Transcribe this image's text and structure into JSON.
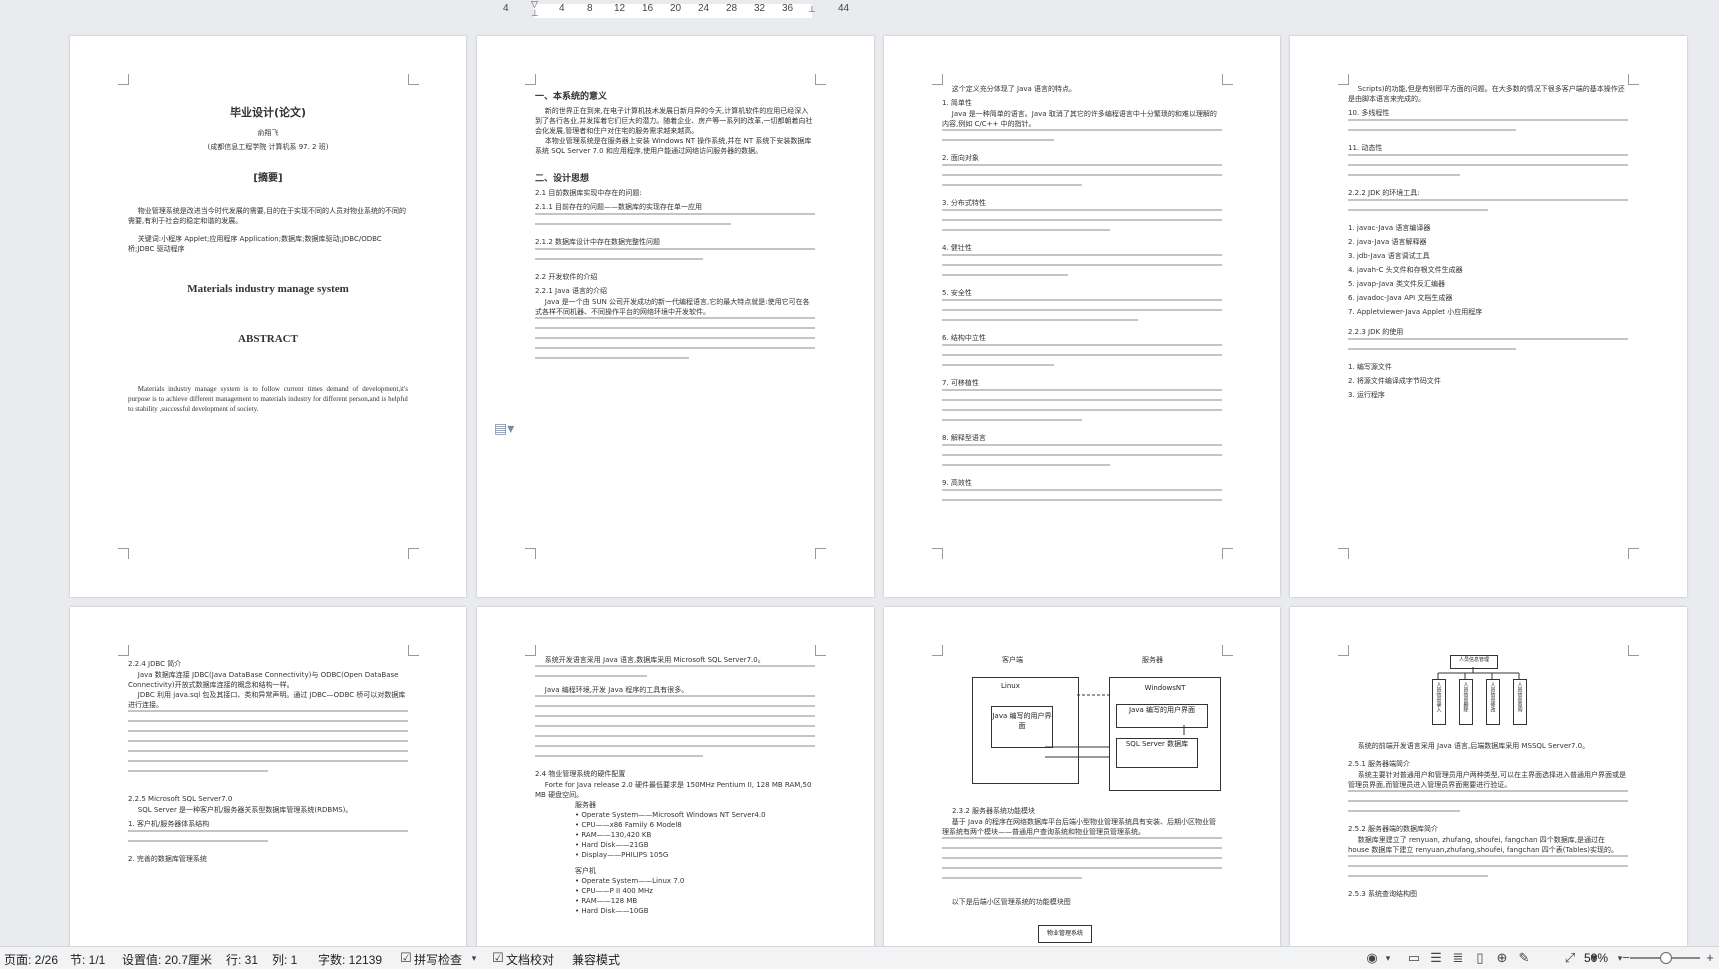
{
  "ruler": {
    "marks": [
      "4",
      "4",
      "8",
      "12",
      "16",
      "20",
      "24",
      "28",
      "32",
      "36",
      "44"
    ]
  },
  "page1": {
    "title": "毕业设计(论文)",
    "author": "俞翔飞",
    "affiliation": "(成都信息工程学院 计算机系 97. 2 班)",
    "abstract_cn_head": "[摘要]",
    "abstract_cn": "物业管理系统是改进当今时代发展的需要,目的在于实现不同的人员对物业系统的不同的需要,有利于社会的稳定和谐的发展。",
    "keywords_cn": "关键词:小程序 Applet;应用程序 Application;数据库;数据库驱动;JDBC/ODBC 桥;JDBC 驱动程序",
    "title_en": "Materials industry manage system",
    "abstract_en_head": "ABSTRACT",
    "abstract_en": "Materials industry manage system is to follow current times demand of development,it's purpose is to achieve different management to materials industry for different person,and is helpful to stability ,successful development of society."
  },
  "page2": {
    "h1": "一、本系统的意义",
    "p1": "新的世界正在到来,在电子计算机技术发展日新月异的今天,计算机软件的应用已经深入到了各行各业,并发挥着它们巨大的潜力。随着企业、房产等一系列的改革,一切都朝着向社会化发展,管理者和住户对住宅的服务需求越来越高。",
    "p2": "本物业管理系统是在服务器上安装 Windows NT 操作系统,并在 NT 系统下安装数据库系统 SQL Server 7.0 和应用程序,使用户能通过网络访问服务器的数据。",
    "h2": "二、设计思想",
    "s1": "2.1 目前数据库实现中存在的问题:",
    "s11": "2.1.1 目前存在的问题——数据库的实现存在单一应用",
    "s12": "2.1.2 数据库设计中存在数据完整性问题",
    "s22": "2.2 开发软件的介绍",
    "s221": "2.2.1 Java 语言的介绍",
    "p3": "Java 是一个由 SUN 公司开发成功的新一代编程语言,它的最大特点就是:使用它可在各式各样不同机器、不同操作平台的网络环境中开发软件。"
  },
  "page3": {
    "p1": "这个定义充分体现了 Java 语言的特点。",
    "items": [
      "1. 简单性",
      "2. 面向对象",
      "3. 分布式特性",
      "4. 健壮性",
      "5. 安全性",
      "6. 结构中立性",
      "7. 可移植性",
      "8. 解释型语言",
      "9. 高效性"
    ],
    "p2": "Java 是一种简单的语言。Java 取消了其它的许多编程语言中十分繁琐的和难以理解的内容,例如 C/C++ 中的指针。"
  },
  "page4": {
    "p1": "Scripts)的功能,但是有别即平方面的问题。在大多数的情况下很多客户端的基本操作还是由脚本语言来完成的。",
    "items": [
      "10. 多线程性",
      "11. 动态性",
      "2.2.2 JDK 的环境工具:",
      "1. javac-Java 语言编译器",
      "2. java-Java 语言解释器",
      "3. jdb-Java 语言调试工具",
      "4. javah-C 头文件和存根文件生成器",
      "5. javap-Java 类文件反汇编器",
      "6. javadoc-Java API 文档生成器",
      "7. Appletviewer-Java Applet 小应用程序",
      "2.2.3 JDK 的使用",
      "1. 编写源文件",
      "2. 将源文件编译成字节码文件",
      "3. 运行程序"
    ]
  },
  "page5": {
    "h": "2.2.4 JDBC 简介",
    "p1": "Java 数据库连接 JDBC(Java DataBase Connectivity)与 ODBC(Open DataBase Connectivity)开放式数据库连接的概念和结构一样。",
    "p2": "JDBC 利用 java.sql 包及其接口、类和异常声明。通过 JDBC—ODBC 桥可以对数据库进行连接。",
    "s": "2.2.5 Microsoft SQL Server7.0",
    "p3": "SQL Server 是一种客户机/服务器关系型数据库管理系统(RDBMS)。",
    "li1": "1. 客户机/服务器体系结构",
    "li2": "2. 完善的数据库管理系统"
  },
  "page6": {
    "p1": "系统开发语言采用 Java 语言,数据库采用 Microsoft SQL Server7.0。",
    "p2": "Java 编程环境,开发 Java 程序的工具有很多。",
    "s": "2.4 物业管理系统的硬件配置",
    "p3": "Forte for Java release 2.0 硬件最低要求是 150MHz Pentium II, 128 MB RAM,50 MB 硬盘空间。",
    "server_head": "服务器",
    "server": [
      "• Operate System——Microsoft Windows NT Server4.0",
      "• CPU——x86 Family 6 Model8",
      "• RAM——130,420 KB",
      "• Hard Disk——21GB",
      "• Display——PHILIPS 105G"
    ],
    "client_head": "客户机",
    "client": [
      "• Operate System——Linux 7.0",
      "• CPU——P II 400 MHz",
      "• RAM——128 MB",
      "• Hard Disk——10GB"
    ]
  },
  "page7": {
    "client_label": "客户端",
    "server_label": "服务器",
    "linux": "Linux",
    "java_ui": "Java 编写的用户界面",
    "winnt": "WindowsNT",
    "java_app": "Java 编写的用户界面",
    "sql": "SQL Server 数据库",
    "section": "2.3.2 服务器系统功能模块",
    "p1": "基于 Java 的程序在网络数据库平台后端小型物业管理系统具有安装、后期小区物业管理系统有两个模块——普通用户查询系统和物业管理员管理系统。",
    "p2": "以下是后端小区管理系统的功能模块图",
    "bottom_box": "物业管理系统"
  },
  "page8": {
    "tree_root": "人员信息管理",
    "tree_children": [
      "人员信息录入",
      "人员信息删除",
      "人员信息修改",
      "人员信息查询"
    ],
    "p1": "系统的前端开发语言采用 Java 语言,后端数据库采用 MSSQL Server7.0。",
    "s1": "2.5.1 服务器端简介",
    "p2": "系统主要针对普通用户和管理员用户两种类型,可以在主界面选择进入普通用户界面或是管理员界面,而管理员进入管理员界面需要进行验证。",
    "s2": "2.5.2 服务器端的数据库简介",
    "p3": "数据库里建立了 renyuan, zhufang, shoufei, fangchan 四个数据库,是通过在 house 数据库下建立 renyuan,zhufang,shoufei, fangchan 四个表(Tables)实现的。",
    "s3": "2.5.3 系统查询结构图"
  },
  "status": {
    "page": "页面: 2/26",
    "section": "节: 1/1",
    "setting": "设置值: 20.7厘米",
    "row": "行: 31",
    "col": "列: 1",
    "words": "字数: 12139",
    "spell": "拼写检查",
    "proof": "文档校对",
    "compat": "兼容模式",
    "zoom": "50%"
  }
}
